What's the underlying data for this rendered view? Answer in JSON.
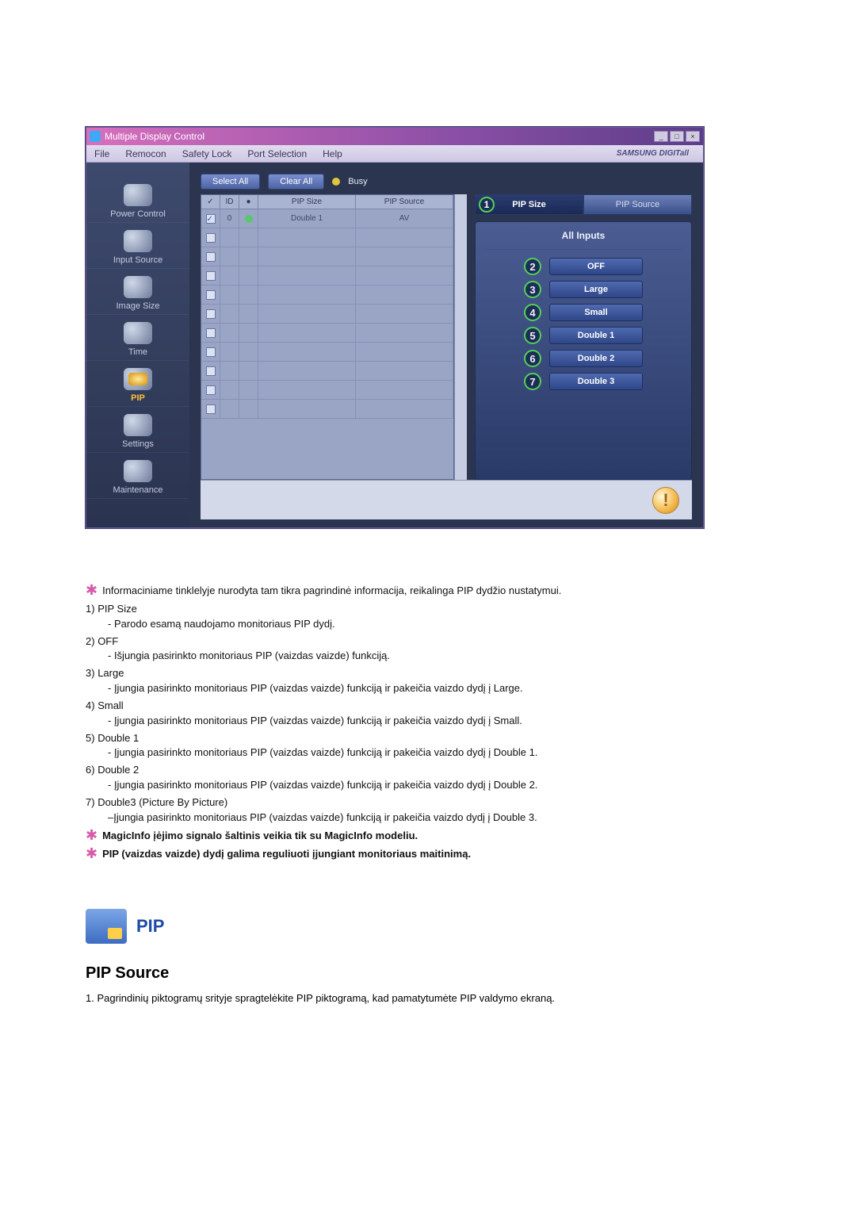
{
  "window": {
    "title": "Multiple Display Control",
    "menu": [
      "File",
      "Remocon",
      "Safety Lock",
      "Port Selection",
      "Help"
    ],
    "brand": "SAMSUNG DIGITall"
  },
  "toolbar": {
    "select_all": "Select All",
    "clear_all": "Clear All",
    "busy": "Busy"
  },
  "sidebar": {
    "items": [
      {
        "label": "Power Control"
      },
      {
        "label": "Input Source"
      },
      {
        "label": "Image Size"
      },
      {
        "label": "Time"
      },
      {
        "label": "PIP"
      },
      {
        "label": "Settings"
      },
      {
        "label": "Maintenance"
      }
    ]
  },
  "grid": {
    "headers": {
      "c1": "✓",
      "c2": "ID",
      "c3": "●",
      "c4": "PIP Size",
      "c5": "PIP Source"
    },
    "row1": {
      "id": "0",
      "pip_size": "Double 1",
      "pip_source": "AV"
    }
  },
  "right": {
    "tabs": {
      "pip_size": "PIP Size",
      "pip_source": "PIP Source",
      "badge": "1"
    },
    "all_inputs": "All Inputs",
    "options": [
      {
        "n": "2",
        "label": "OFF"
      },
      {
        "n": "3",
        "label": "Large"
      },
      {
        "n": "4",
        "label": "Small"
      },
      {
        "n": "5",
        "label": "Double 1"
      },
      {
        "n": "6",
        "label": "Double 2"
      },
      {
        "n": "7",
        "label": "Double 3"
      }
    ]
  },
  "desc": {
    "intro": "Informaciniame tinklelyje nurodyta tam tikra pagrindinė informacija, reikalinga PIP dydžio nustatymui.",
    "items": [
      {
        "n": "1)",
        "t": "PIP Size",
        "s": "- Parodo esamą naudojamo monitoriaus PIP dydį."
      },
      {
        "n": "2)",
        "t": "OFF",
        "s": "- Išjungia pasirinkto monitoriaus PIP (vaizdas vaizde) funkciją."
      },
      {
        "n": "3)",
        "t": "Large",
        "s": "- Įjungia pasirinkto monitoriaus PIP (vaizdas vaizde) funkciją ir pakeičia vaizdo dydį į Large."
      },
      {
        "n": "4)",
        "t": "Small",
        "s": "- Įjungia pasirinkto monitoriaus PIP (vaizdas vaizde) funkciją ir pakeičia vaizdo dydį į Small."
      },
      {
        "n": "5)",
        "t": "Double 1",
        "s": "- Įjungia pasirinkto monitoriaus PIP (vaizdas vaizde) funkciją ir pakeičia vaizdo dydį į Double 1."
      },
      {
        "n": "6)",
        "t": "Double 2",
        "s": "- Įjungia pasirinkto monitoriaus PIP (vaizdas vaizde) funkciją ir pakeičia vaizdo dydį į Double 2."
      },
      {
        "n": "7)",
        "t": "Double3 (Picture By Picture)",
        "s": "–Įjungia pasirinkto monitoriaus PIP (vaizdas vaizde) funkciją ir pakeičia vaizdo dydį į Double 3."
      }
    ],
    "note1": "MagicInfo įėjimo signalo šaltinis veikia tik su MagicInfo modeliu.",
    "note2": "PIP (vaizdas vaizde) dydį galima reguliuoti įjungiant monitoriaus maitinimą."
  },
  "bottom": {
    "pip_title": "PIP",
    "sub_title": "PIP Source",
    "line1": "1. Pagrindinių piktogramų srityje spragtelėkite PIP piktogramą, kad pamatytumėte PIP valdymo ekraną."
  }
}
